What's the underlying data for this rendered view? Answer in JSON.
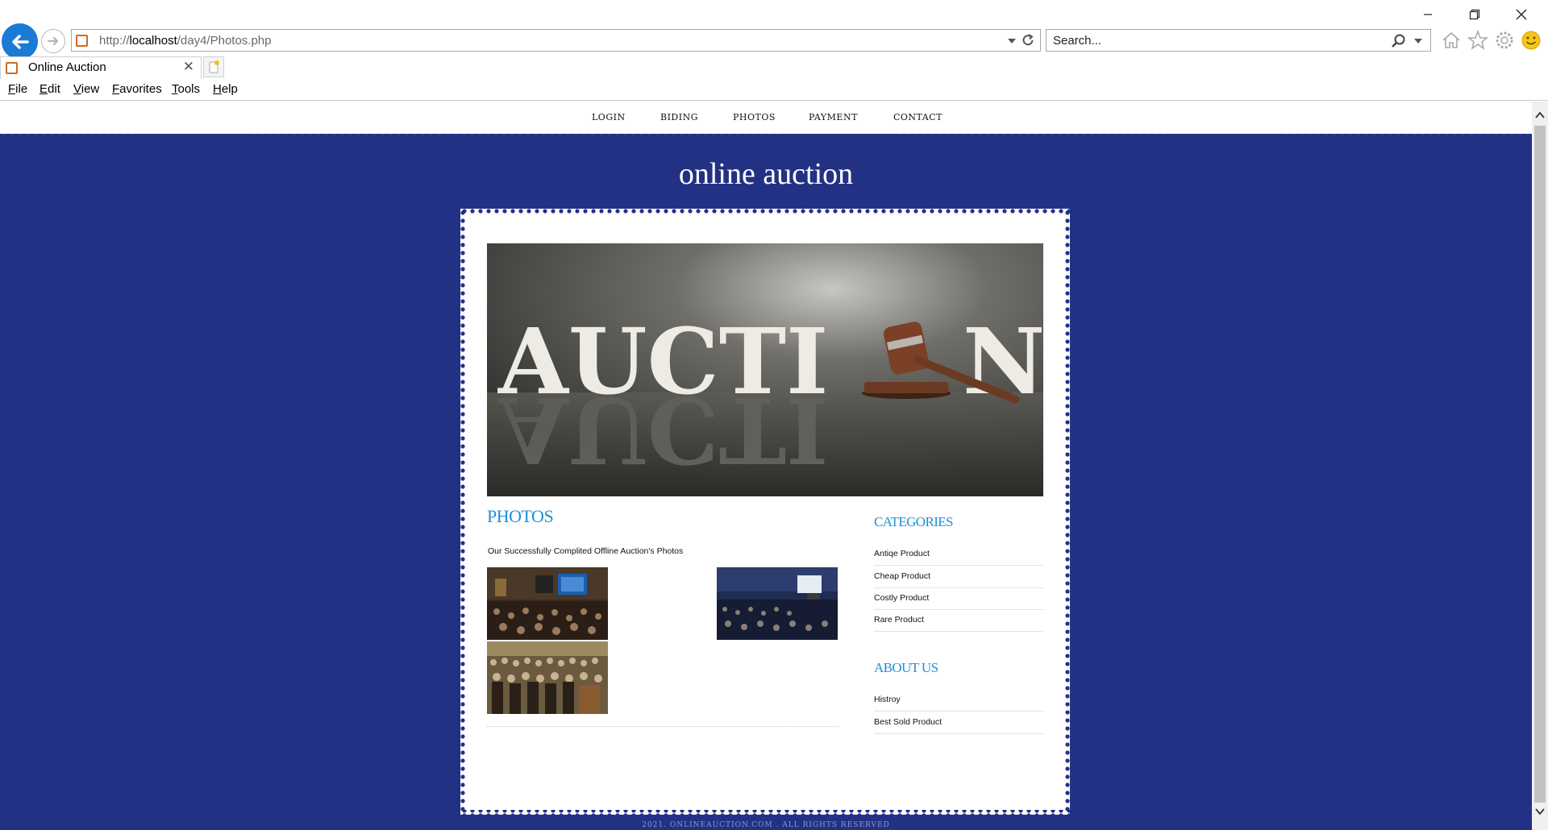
{
  "browser": {
    "address_url_prefix": "http://",
    "address_url_host": "localhost",
    "address_url_path": "/day4/Photos.php",
    "search_placeholder": "Search...",
    "tab_title": "Online Auction",
    "menu": [
      "File",
      "Edit",
      "View",
      "Favorites",
      "Tools",
      "Help"
    ]
  },
  "site": {
    "nav": [
      "LOGIN",
      "BIDING",
      "PHOTOS",
      "PAYMENT",
      "CONTACT"
    ],
    "title": "online auction",
    "hero_word": "AUCTI",
    "hero_word_end": "N",
    "photos_heading": "PHOTOS",
    "photos_description": "Our Successfully Complited Offline Auction's Photos",
    "categories_heading": "CATEGORIES",
    "categories": [
      "Antiqe Product",
      "Cheap Product",
      "Costly Product",
      "Rare Product"
    ],
    "about_heading": "ABOUT US",
    "about_items": [
      "Histroy",
      "Best Sold Product"
    ],
    "footer": "2021. ONLINEAUCTION.COM . ALL RIGHTS RESERVED"
  },
  "colors": {
    "page_blue": "#233185",
    "link_blue": "#1e8fd8",
    "browser_back": "#1a7ad6"
  }
}
